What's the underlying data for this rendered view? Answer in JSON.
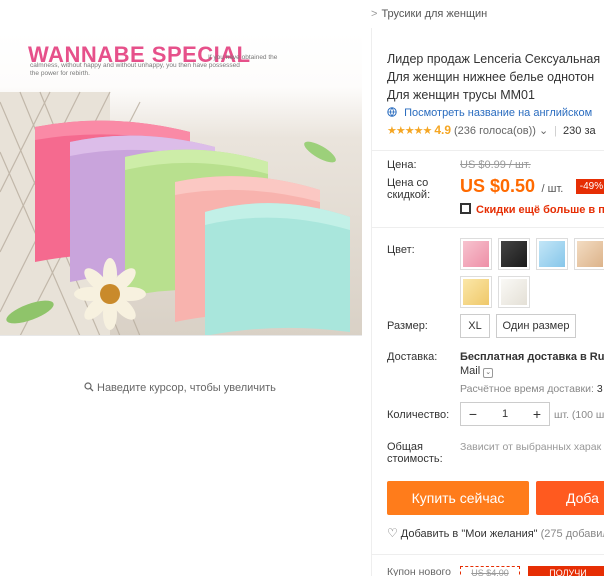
{
  "breadcrumb": {
    "separator": ">",
    "current": "Трусики для женщин"
  },
  "product_image": {
    "title": "WANNABE SPECIAL",
    "caption_line1": "If you have obtained the",
    "caption_line2": "calmness, without happy and without unhappy, you then have possessed",
    "caption_line3": "the power for rebirth."
  },
  "zoom_hint": "Наведите курсор, чтобы увеличить",
  "product": {
    "title_lines": [
      "Лидер продаж Lenceria Сексуальная",
      "Для женщин нижнее белье однотон",
      "Для женщин трусы MM01"
    ],
    "translate_link": "Посмотреть название на английском",
    "stars": "★★★★★",
    "rating": "4.9",
    "votes": "(236 голоса(ов))",
    "votes_caret": "⌄",
    "orders": "230 за"
  },
  "price": {
    "label": "Цена:",
    "old": "US $0.99 / шт.",
    "discount_label_1": "Цена со",
    "discount_label_2": "скидкой:",
    "new": "US $0.50",
    "unit": "/ шт.",
    "percent": "-49%",
    "coupon_promo": "Скидки ещё больше в при"
  },
  "color": {
    "label": "Цвет:",
    "swatches": [
      {
        "name": "pink",
        "color": "#f2a9b8"
      },
      {
        "name": "black",
        "color": "#2b2b2b"
      },
      {
        "name": "blue",
        "color": "#9fd3ef"
      },
      {
        "name": "beige",
        "color": "#e9c9a6"
      },
      {
        "name": "yellow",
        "color": "#f4d98a"
      },
      {
        "name": "white",
        "color": "#f1efe9"
      }
    ]
  },
  "size": {
    "label": "Размер:",
    "options": [
      "XL",
      "Один размер"
    ]
  },
  "shipping": {
    "label": "Доставка:",
    "main": "Бесплатная доставка в Russ",
    "carrier": "Mail",
    "caret": "⌄",
    "estimate_label": "Расчётное время доставки:",
    "estimate_value": "3"
  },
  "quantity": {
    "label": "Количество:",
    "minus": "−",
    "value": "1",
    "plus": "+",
    "note": "шт. (100 шт"
  },
  "total": {
    "label_1": "Общая",
    "label_2": "стоимость:",
    "note": "Зависит от выбранных харак"
  },
  "actions": {
    "buy_now": "Купить сейчас",
    "add_to_cart": "Доба"
  },
  "wishlist": {
    "icon": "♡",
    "text": "Добавить в \"Мои желания\"",
    "count": "(275 добавил"
  },
  "coupon": {
    "label": "Купон нового",
    "value": "US $4.00",
    "button": "ПОЛУЧИ"
  },
  "colors": {
    "accent": "#ff6a00",
    "sale": "#e62e04",
    "link": "#2a6cbf",
    "star": "#f5a623"
  }
}
